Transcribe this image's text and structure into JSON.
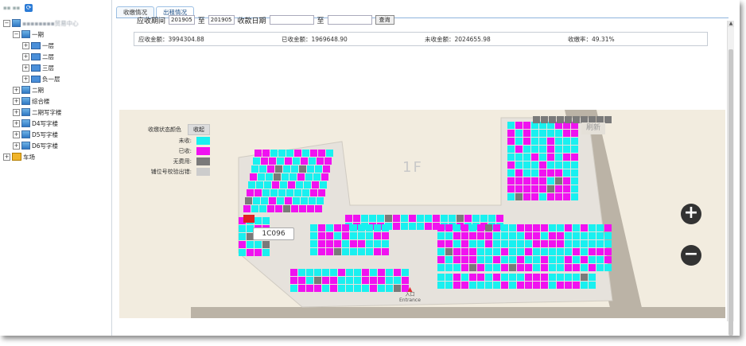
{
  "sidebar": {
    "title": "▪▪ ▪▪",
    "tree": [
      {
        "label": "▪▪▪▪▪▪▪▪贸易中心",
        "toggle": "−",
        "kind": "root"
      },
      {
        "label": "一期",
        "toggle": "−",
        "kind": "building"
      },
      {
        "label": "一层",
        "toggle": "+",
        "kind": "floor"
      },
      {
        "label": "二层",
        "toggle": "+",
        "kind": "floor"
      },
      {
        "label": "三层",
        "toggle": "+",
        "kind": "floor"
      },
      {
        "label": "负一层",
        "toggle": "+",
        "kind": "floor"
      },
      {
        "label": "二期",
        "toggle": "+",
        "kind": "building"
      },
      {
        "label": "综合楼",
        "toggle": "+",
        "kind": "building"
      },
      {
        "label": "二期写字楼",
        "toggle": "+",
        "kind": "building"
      },
      {
        "label": "D4写字楼",
        "toggle": "+",
        "kind": "building"
      },
      {
        "label": "D5写字楼",
        "toggle": "+",
        "kind": "building"
      },
      {
        "label": "D6写字楼",
        "toggle": "+",
        "kind": "building"
      },
      {
        "label": "车场",
        "toggle": "+",
        "kind": "parking"
      }
    ]
  },
  "tabs": [
    {
      "label": "收缴情况",
      "active": true
    },
    {
      "label": "出租情况",
      "active": false
    }
  ],
  "filter": {
    "period_label": "应收期间",
    "from_value": "201905",
    "to_label": "至",
    "to_value": "201905",
    "paid_date_label": "收款日期",
    "to_label2": "至",
    "query_button": "查询"
  },
  "summary": [
    {
      "label": "应收金额：3994304.88"
    },
    {
      "label": "已收金额：1969648.90"
    },
    {
      "label": "未收金额：2024655.98"
    },
    {
      "label": "收缴率：49.31%"
    }
  ],
  "map": {
    "legend_title": "收缴状态颜色",
    "legend_button": "收起",
    "legend": [
      {
        "label": "未收:",
        "color": "#19f0f0"
      },
      {
        "label": "已收:",
        "color": "#f012f0"
      },
      {
        "label": "无费用:",
        "color": "#7a7a7a"
      },
      {
        "label": "铺位号校验出错:",
        "color": "#cccccc"
      }
    ],
    "floor_label": "1F",
    "selected_unit": "1C096",
    "refresh_label": "刷新",
    "entrance_cn": "入口",
    "entrance_en": "Entrance",
    "zoom_in": "+",
    "zoom_out": "−"
  },
  "colors": {
    "unpaid": "#19f0f0",
    "paid": "#f012f0",
    "no_fee": "#7a7a7a",
    "error": "#cccccc",
    "selected": "#e02020",
    "floor_bg": "#f2ecdf",
    "road": "#bbb3a6"
  }
}
